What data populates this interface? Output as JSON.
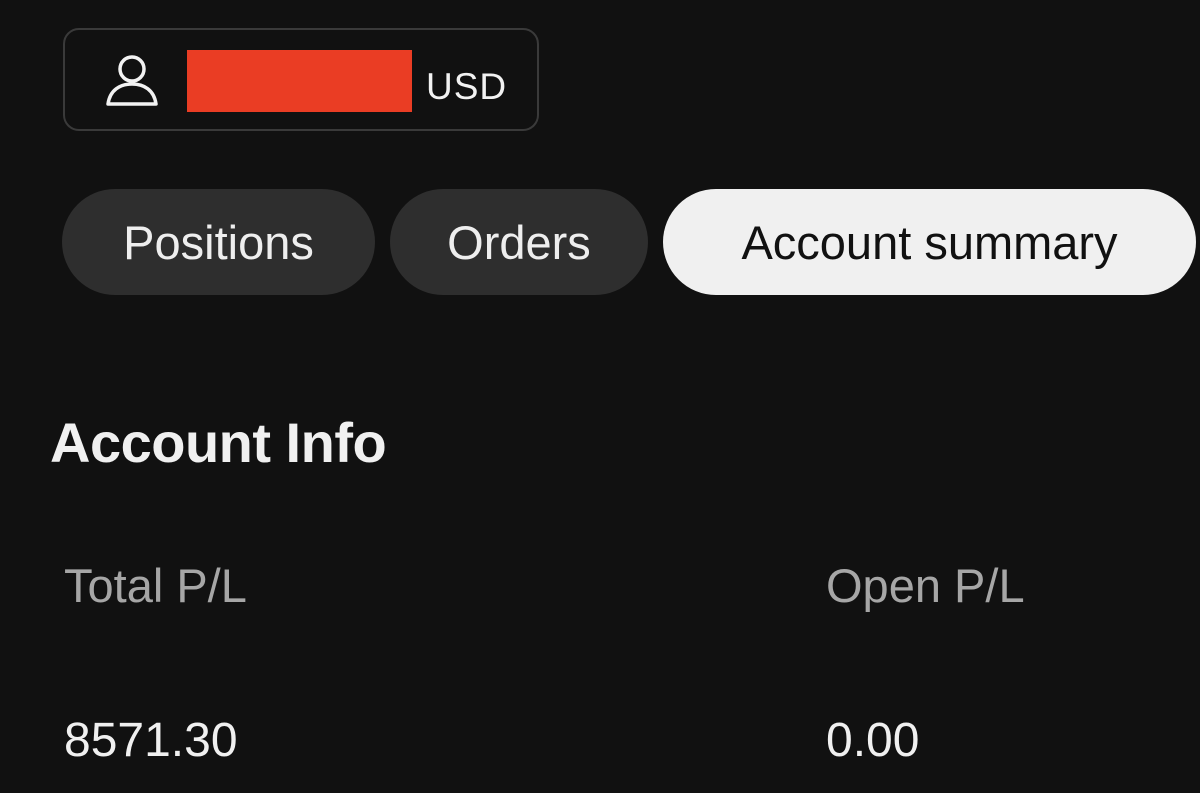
{
  "account": {
    "currency": "USD",
    "icon": "user-icon",
    "redaction_color": "#ea3d24"
  },
  "tabs": [
    {
      "label": "Positions",
      "active": false
    },
    {
      "label": "Orders",
      "active": false
    },
    {
      "label": "Account summary",
      "active": true
    }
  ],
  "account_info": {
    "title": "Account Info",
    "fields": [
      {
        "label": "Total P/L",
        "value": "8571.30"
      },
      {
        "label": "Open P/L",
        "value": "0.00"
      }
    ]
  }
}
